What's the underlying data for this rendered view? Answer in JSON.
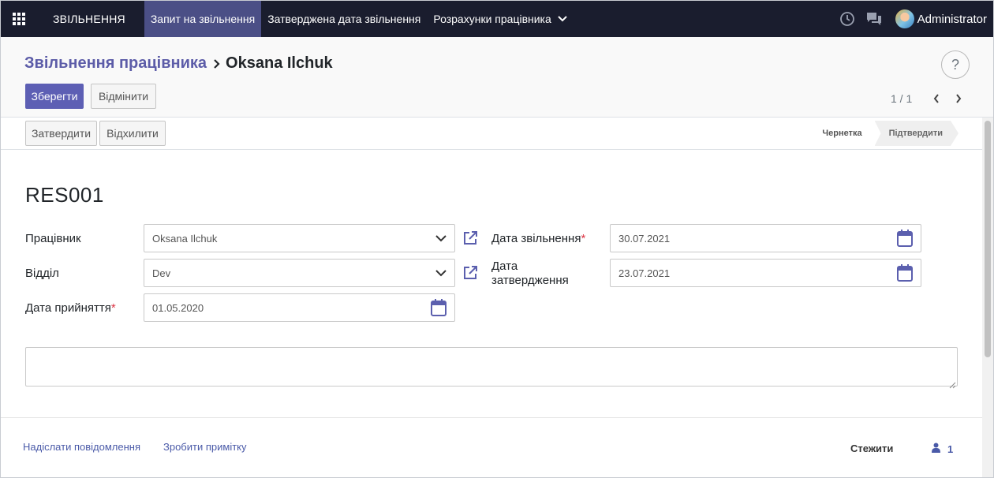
{
  "navbar": {
    "apps_icon": "grid-icon",
    "brand": "ЗВІЛЬНЕННЯ",
    "menu": [
      {
        "label": "Запит на звільнення",
        "active": true
      },
      {
        "label": "Затверджена дата звільнення",
        "active": false
      },
      {
        "label": "Розрахунки працівника",
        "active": false,
        "has_dropdown": true
      }
    ],
    "icons": [
      "clock-icon",
      "chat-icon"
    ],
    "user": "Administrator"
  },
  "breadcrumb": {
    "parent": "Звільнення працівника",
    "current": "Oksana Ilchuk"
  },
  "help": {
    "label": "?"
  },
  "actions": {
    "save": "Зберегти",
    "discard": "Відмінити"
  },
  "pager": {
    "value": "1 / 1"
  },
  "status": {
    "buttons": {
      "approve": "Затвердити",
      "reject": "Відхилити"
    },
    "stages": [
      {
        "label": "Чернетка",
        "current": false
      },
      {
        "label": "Підтвердити",
        "current": true
      }
    ]
  },
  "form": {
    "record_name": "RES001",
    "employee": {
      "label": "Працівник",
      "value": "Oksana Ilchuk"
    },
    "department": {
      "label": "Відділ",
      "value": "Dev"
    },
    "joined_date": {
      "label": "Дата прийняття",
      "value": "01.05.2020",
      "required": true
    },
    "resign_date": {
      "label": "Дата звільнення",
      "value": "30.07.2021",
      "required": true
    },
    "approved_date": {
      "label_line1": "Дата",
      "label_line2": "затвердження",
      "value": "23.07.2021"
    },
    "note": ""
  },
  "chatter": {
    "send_message": "Надіслати повідомлення",
    "log_note": "Зробити примітку",
    "follow": "Стежити",
    "followers_count": "1"
  },
  "colors": {
    "navbar_bg": "#1a1d2e",
    "active_menu": "#4b4f86",
    "primary": "#5d5fb4",
    "breadcrumb_link": "#5c5ca8",
    "required": "#dc3545"
  }
}
